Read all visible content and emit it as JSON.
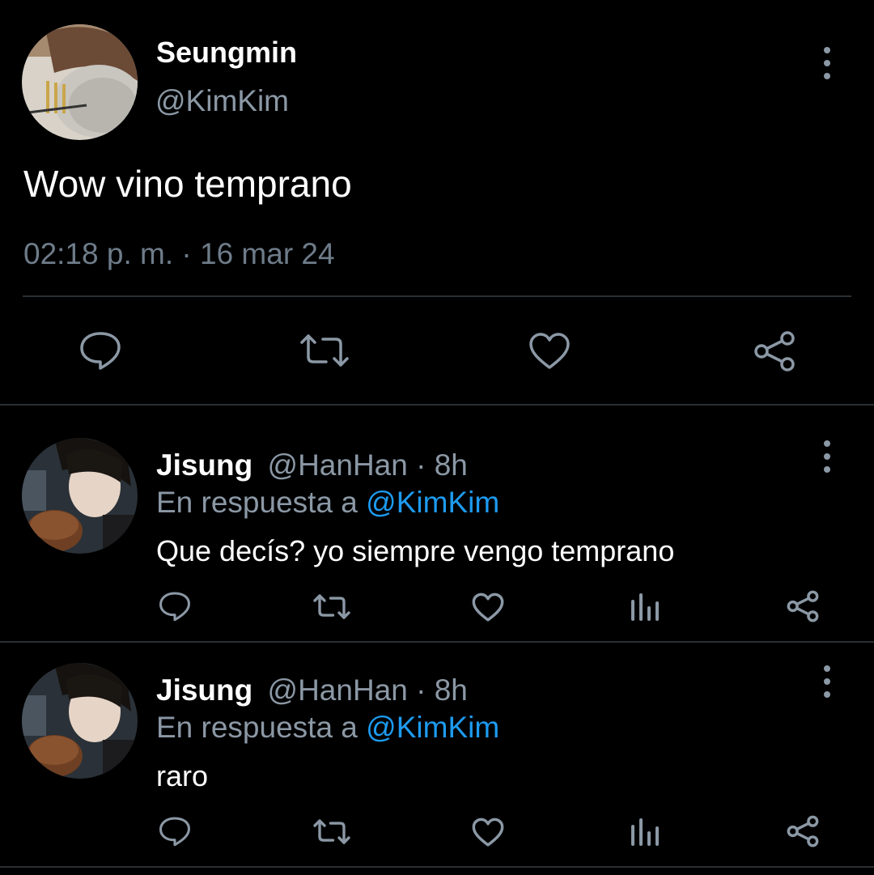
{
  "main_tweet": {
    "author_name": "Seungmin",
    "author_handle": "@KimKim",
    "text": "Wow vino temprano",
    "timestamp": "02:18 p. m. · 16 mar 24",
    "actions": [
      "reply-icon",
      "retweet-icon",
      "like-icon",
      "share-icon"
    ]
  },
  "replies": [
    {
      "author_name": "Jisung",
      "meta": "@HanHan · 8h",
      "reply_prefix": "En respuesta a ",
      "reply_mention": "@KimKim",
      "text": "Que decís? yo siempre vengo temprano",
      "actions": [
        "reply-icon",
        "retweet-icon",
        "like-icon",
        "analytics-icon",
        "share-icon"
      ]
    },
    {
      "author_name": "Jisung",
      "meta": "@HanHan · 8h",
      "reply_prefix": "En respuesta a ",
      "reply_mention": "@KimKim",
      "text": "raro",
      "actions": [
        "reply-icon",
        "retweet-icon",
        "like-icon",
        "analytics-icon",
        "share-icon"
      ]
    }
  ],
  "colors": {
    "background": "#000000",
    "text_primary": "#ffffff",
    "text_secondary": "#8b98a5",
    "mention": "#1d9bf0",
    "divider": "#2a2f33"
  }
}
